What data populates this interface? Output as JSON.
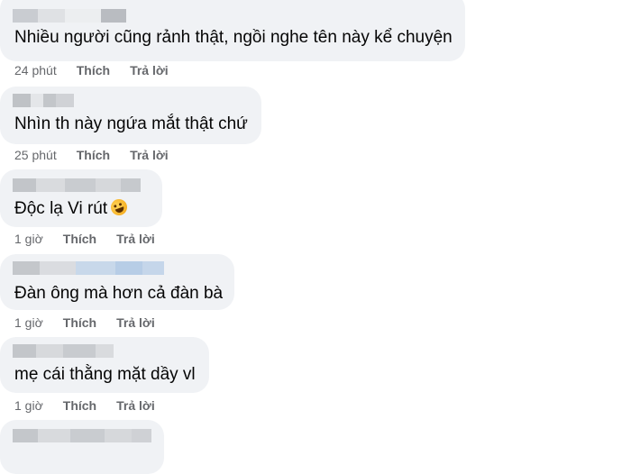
{
  "comments": [
    {
      "text": "Nhiều người cũng rảnh thật, ngồi nghe tên này kể chuyện",
      "time": "24 phút",
      "like": "Thích",
      "reply": "Trả lời"
    },
    {
      "text": "Nhìn th này ngứa mắt thật chứ",
      "time": "25 phút",
      "like": "Thích",
      "reply": "Trả lời"
    },
    {
      "text": "Độc lạ Vi rút",
      "emoji": "grinning-squinting-face",
      "time": "1 giờ",
      "like": "Thích",
      "reply": "Trả lời"
    },
    {
      "text": "Đàn ông mà hơn cả đàn bà",
      "time": "1 giờ",
      "like": "Thích",
      "reply": "Trả lời"
    },
    {
      "text": "mẹ cái thằng mặt dầy vl",
      "time": "1 giờ",
      "like": "Thích",
      "reply": "Trả lời"
    }
  ]
}
